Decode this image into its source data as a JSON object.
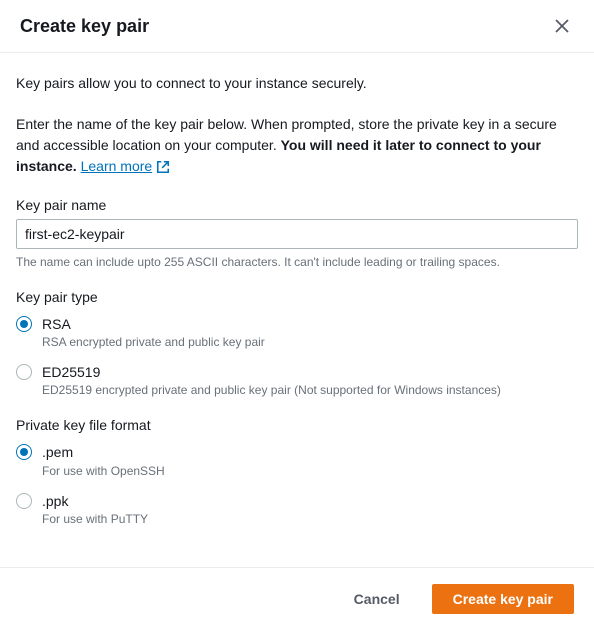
{
  "header": {
    "title": "Create key pair"
  },
  "body": {
    "intro": "Key pairs allow you to connect to your instance securely.",
    "instruction_prefix": "Enter the name of the key pair below. When prompted, store the private key in a secure and accessible location on your computer. ",
    "instruction_bold": "You will need it later to connect to your instance. ",
    "learn_more": "Learn more",
    "name_field": {
      "label": "Key pair name",
      "value": "first-ec2-keypair",
      "helper": "The name can include upto 255 ASCII characters. It can't include leading or trailing spaces."
    },
    "type_group": {
      "label": "Key pair type",
      "options": [
        {
          "label": "RSA",
          "description": "RSA encrypted private and public key pair",
          "selected": true
        },
        {
          "label": "ED25519",
          "description": "ED25519 encrypted private and public key pair (Not supported for Windows instances)",
          "selected": false
        }
      ]
    },
    "format_group": {
      "label": "Private key file format",
      "options": [
        {
          "label": ".pem",
          "description": "For use with OpenSSH",
          "selected": true
        },
        {
          "label": ".ppk",
          "description": "For use with PuTTY",
          "selected": false
        }
      ]
    }
  },
  "footer": {
    "cancel": "Cancel",
    "submit": "Create key pair"
  }
}
